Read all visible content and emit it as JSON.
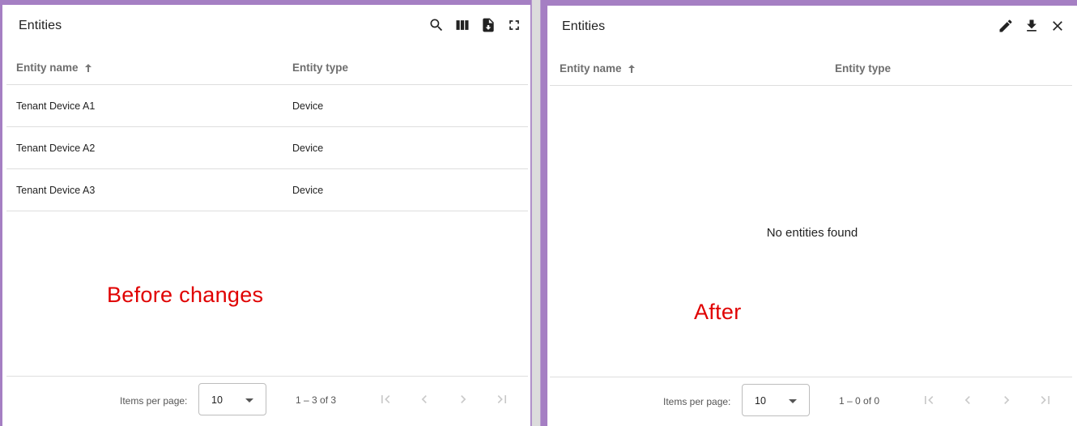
{
  "left_panel": {
    "title": "Entities",
    "toolbar_icons": [
      "search-icon",
      "columns-icon",
      "export-file-icon",
      "fullscreen-icon"
    ],
    "columns": {
      "name": "Entity name",
      "type": "Entity type"
    },
    "rows": [
      {
        "name": "Tenant Device A1",
        "type": "Device"
      },
      {
        "name": "Tenant Device A2",
        "type": "Device"
      },
      {
        "name": "Tenant Device A3",
        "type": "Device"
      }
    ],
    "annotation": "Before changes",
    "paginator": {
      "items_per_page_label": "Items per page:",
      "page_size": "10",
      "range_label": "1 – 3 of 3"
    }
  },
  "right_panel": {
    "title": "Entities",
    "toolbar_icons": [
      "edit-icon",
      "download-icon",
      "close-icon"
    ],
    "columns": {
      "name": "Entity name",
      "type": "Entity type"
    },
    "empty_message": "No entities found",
    "annotation": "After",
    "paginator": {
      "items_per_page_label": "Items per page:",
      "page_size": "10",
      "range_label": "1 – 0 of 0"
    }
  },
  "colors": {
    "annotation": "#e00000",
    "background": "#a57fc3",
    "panel": "#ffffff"
  }
}
